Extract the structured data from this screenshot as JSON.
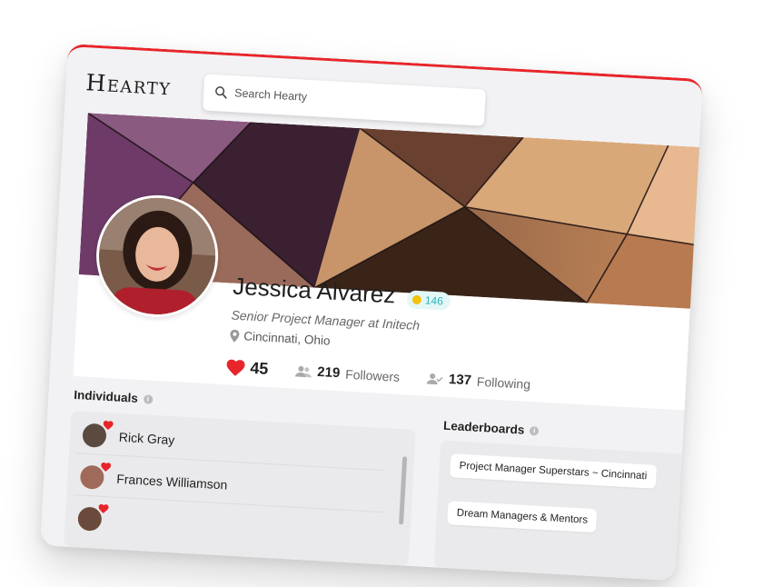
{
  "app": {
    "logo": "Hearty"
  },
  "search": {
    "placeholder": "Search Hearty"
  },
  "profile": {
    "name": "Jessica Alvarez",
    "badge_points": "146",
    "title": "Senior Project Manager at Initech",
    "location": "Cincinnati, Ohio",
    "hearts": "45",
    "followers_count": "219",
    "followers_label": "Followers",
    "following_count": "137",
    "following_label": "Following"
  },
  "individuals": {
    "heading": "Individuals",
    "items": [
      {
        "name": "Rick Gray"
      },
      {
        "name": "Frances Williamson"
      }
    ]
  },
  "leaderboards": {
    "heading": "Leaderboards",
    "items": [
      {
        "label": "Project Manager Superstars ~ Cincinnati"
      },
      {
        "label": "Dream Managers & Mentors"
      }
    ]
  },
  "colors": {
    "accent_red": "#e8252a",
    "heart_red": "#e8252a",
    "badge_teal": "#2ab4b9",
    "badge_bg": "#e4f7f7"
  },
  "icons": {
    "search": "search-icon",
    "badge": "sun-badge-icon",
    "location": "map-pin-icon",
    "hearts": "heart-icon",
    "followers": "users-icon",
    "following": "user-check-icon",
    "info": "info-icon"
  }
}
